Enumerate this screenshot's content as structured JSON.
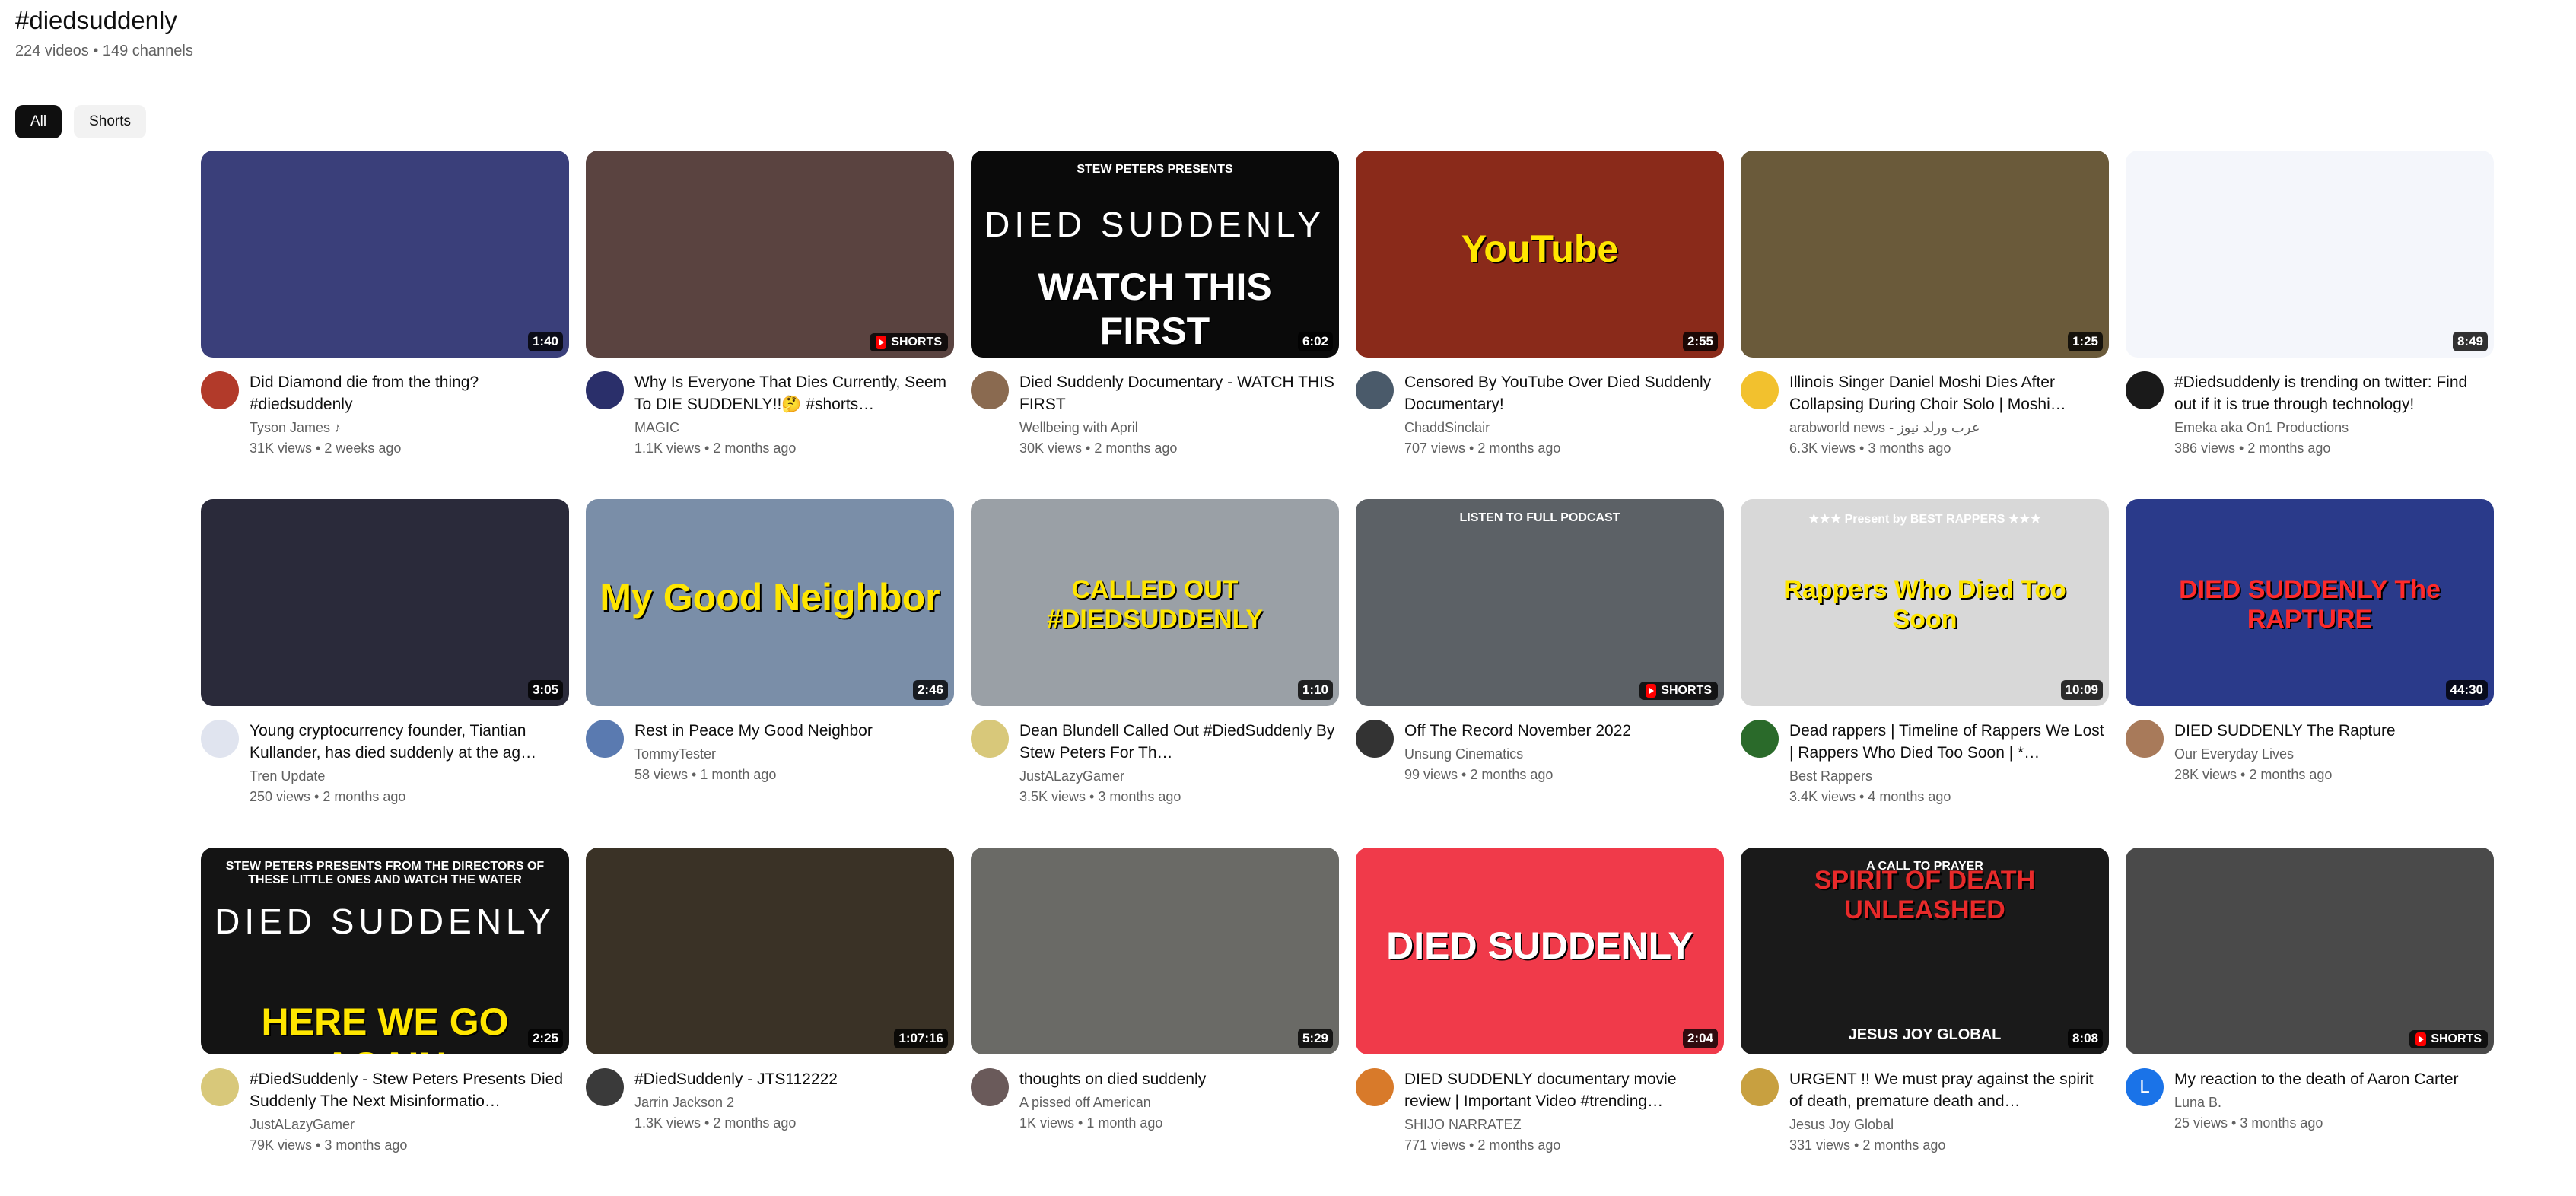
{
  "page": {
    "title": "#diedsuddenly",
    "subtitle": "224 videos • 149 channels"
  },
  "filters": [
    {
      "label": "All",
      "selected": true
    },
    {
      "label": "Shorts",
      "selected": false
    }
  ],
  "shorts_badge_label": "SHORTS",
  "videos": [
    {
      "title": "Did Diamond die from the thing? #diedsuddenly",
      "channel": "Tyson James ♪",
      "stats": "31K views • 2 weeks ago",
      "duration": "1:40",
      "avatar_color": "#b23a2a",
      "thumb_color": "#3a3f7a"
    },
    {
      "title": "Why Is Everyone That Dies Currently, Seem To DIE SUDDENLY!!🤔 #shorts…",
      "channel": "MAGIC",
      "stats": "1.1K views • 2 months ago",
      "duration": "",
      "avatar_color": "#2a2f6a",
      "thumb_color": "#5a4340",
      "short": true
    },
    {
      "title": "Died Suddenly Documentary - WATCH THIS FIRST",
      "channel": "Wellbeing with April",
      "stats": "30K views • 2 months ago",
      "duration": "6:02",
      "avatar_color": "#8a6a50",
      "thumb_color": "#0a0a0a",
      "overlay": "WATCH THIS FIRST",
      "overlay_top": "DIED SUDDENLY",
      "overlay_small": "STEW PETERS PRESENTS"
    },
    {
      "title": "Censored By YouTube Over Died Suddenly Documentary!",
      "channel": "ChaddSinclair",
      "stats": "707 views • 2 months ago",
      "duration": "2:55",
      "avatar_color": "#4a5a6a",
      "thumb_color": "#8a2a1a",
      "overlay": "YouTube"
    },
    {
      "title": "Illinois Singer Daniel Moshi Dies After Collapsing During Choir Solo | Moshi…",
      "channel": "arabworld news - عرب ورلد نيوز",
      "stats": "6.3K views • 3 months ago",
      "duration": "1:25",
      "avatar_color": "#f2c12e",
      "thumb_color": "#6a5a3a"
    },
    {
      "title": "#Diedsuddenly is trending on twitter: Find out if it is true through technology!",
      "channel": "Emeka aka On1 Productions",
      "stats": "386 views • 2 months ago",
      "duration": "8:49",
      "avatar_color": "#1a1a1a",
      "thumb_color": "#f4f6fb"
    },
    {
      "title": "Young cryptocurrency founder, Tiantian Kullander, has died suddenly at the ag…",
      "channel": "Tren  Update",
      "stats": "250 views • 2 months ago",
      "duration": "3:05",
      "avatar_color": "#e0e4ef",
      "thumb_color": "#2a2a3a"
    },
    {
      "title": "Rest in Peace My Good Neighbor",
      "channel": "TommyTester",
      "stats": "58 views • 1 month ago",
      "duration": "2:46",
      "avatar_color": "#5a7ab0",
      "thumb_color": "#7a8ea8",
      "overlay": "My Good Neighbor"
    },
    {
      "title": "Dean Blundell Called Out #DiedSuddenly By Stew Peters For Th…",
      "channel": "JustALazyGamer",
      "stats": "3.5K views • 3 months ago",
      "duration": "1:10",
      "avatar_color": "#d8c87a",
      "thumb_color": "#9aa0a6",
      "overlay": "CALLED OUT #DIEDSUDDENLY"
    },
    {
      "title": "Off The Record November 2022",
      "channel": "Unsung Cinematics",
      "stats": "99 views • 2 months ago",
      "duration": "",
      "avatar_color": "#333333",
      "thumb_color": "#5c6166",
      "short": true,
      "overlay_small": "LISTEN TO FULL PODCAST"
    },
    {
      "title": "Dead rappers | Timeline of Rappers We Lost | Rappers Who Died Too Soon | *…",
      "channel": "Best Rappers",
      "stats": "3.4K views • 4 months ago",
      "duration": "10:09",
      "avatar_color": "#2a6a2a",
      "thumb_color": "#d8d8d8",
      "overlay": "Rappers Who Died Too Soon",
      "overlay_small": "★★★ Present by BEST RAPPERS ★★★"
    },
    {
      "title": "DIED SUDDENLY The Rapture",
      "channel": "Our Everyday Lives",
      "stats": "28K views • 2 months ago",
      "duration": "44:30",
      "avatar_color": "#a87a5a",
      "thumb_color": "#2a3a8a",
      "overlay": "DIED SUDDENLY The RAPTURE"
    },
    {
      "title": "#DiedSuddenly - Stew Peters Presents Died Suddenly The Next Misinformatio…",
      "channel": "JustALazyGamer",
      "stats": "79K views • 3 months ago",
      "duration": "2:25",
      "avatar_color": "#d8c87a",
      "thumb_color": "#141414",
      "overlay": "HERE WE GO AGAIN",
      "overlay_top": "DIED SUDDENLY",
      "overlay_small": "STEW PETERS PRESENTS FROM THE DIRECTORS OF THESE LITTLE ONES AND WATCH THE WATER"
    },
    {
      "title": "#DiedSuddenly - JTS112222",
      "channel": "Jarrin Jackson 2",
      "stats": "1.3K views • 2 months ago",
      "duration": "1:07:16",
      "avatar_color": "#3a3a3a",
      "thumb_color": "#3a3226"
    },
    {
      "title": "thoughts on died suddenly",
      "channel": "A pissed off American",
      "stats": "1K views • 1 month ago",
      "duration": "5:29",
      "avatar_color": "#6a5a5a",
      "thumb_color": "#6a6a66"
    },
    {
      "title": "DIED SUDDENLY documentary movie review | Important Video #trending…",
      "channel": "SHIJO NARRATEZ",
      "stats": "771 views • 2 months ago",
      "duration": "2:04",
      "avatar_color": "#d87a2a",
      "thumb_color": "#f03a4a",
      "overlay": "DIED SUDDENLY"
    },
    {
      "title": "URGENT !! We must pray against the spirit of death, premature death and…",
      "channel": "Jesus Joy Global",
      "stats": "331 views • 2 months ago",
      "duration": "8:08",
      "avatar_color": "#c8a040",
      "thumb_color": "#1a1a1a",
      "overlay": "SPIRIT OF DEATH UNLEASHED",
      "overlay_small": "A CALL TO PRAYER",
      "overlay_bottom": "JESUS JOY GLOBAL"
    },
    {
      "title": "My reaction to the death of Aaron Carter",
      "channel": "Luna B.",
      "stats": "25 views • 3 months ago",
      "duration": "",
      "avatar_color": "#1a73e8",
      "thumb_color": "#4a4a4a",
      "short": true,
      "avatar_letter": "L"
    }
  ]
}
